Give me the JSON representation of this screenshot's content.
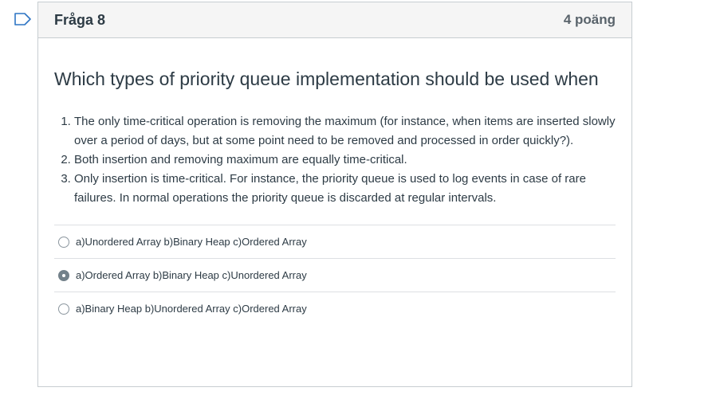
{
  "question": {
    "title": "Fråga 8",
    "points": "4 poäng",
    "heading": "Which types of priority queue implementation should be used when",
    "cases": [
      "The only time-critical operation is removing the maximum (for instance, when items are inserted slowly over a period of days, but at some point need to be removed and processed in order quickly?).",
      "Both insertion and removing maximum are equally time-critical.",
      "Only insertion is time-critical. For instance, the priority queue is used to log events in case of rare failures. In normal operations the priority queue is discarded at regular intervals."
    ]
  },
  "answers": [
    {
      "label": "a)Unordered Array b)Binary Heap c)Ordered Array",
      "selected": false
    },
    {
      "label": "a)Ordered Array b)Binary Heap c)Unordered Array",
      "selected": true
    },
    {
      "label": "a)Binary Heap b)Unordered Array c)Ordered Array",
      "selected": false
    }
  ],
  "colors": {
    "flag_outline": "#2d75c4",
    "border": "#c7cdd1",
    "header_bg": "#f5f5f5",
    "text": "#2d3b45"
  },
  "icons": {
    "flag": "flag-outline-icon"
  }
}
